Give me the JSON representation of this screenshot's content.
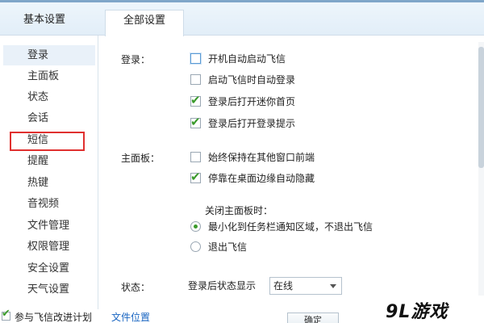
{
  "tabs": [
    {
      "label": "基本设置"
    },
    {
      "label": "全部设置"
    }
  ],
  "sidebar": {
    "items": [
      {
        "label": "登录"
      },
      {
        "label": "主面板"
      },
      {
        "label": "状态"
      },
      {
        "label": "会话"
      },
      {
        "label": "短信"
      },
      {
        "label": "提醒"
      },
      {
        "label": "热键"
      },
      {
        "label": "音视频"
      },
      {
        "label": "文件管理"
      },
      {
        "label": "权限管理"
      },
      {
        "label": "安全设置"
      },
      {
        "label": "天气设置"
      }
    ]
  },
  "login": {
    "label": "登录：",
    "options": [
      {
        "label": "开机自动启动飞信",
        "checked": false
      },
      {
        "label": "启动飞信时自动登录",
        "checked": false
      },
      {
        "label": "登录后打开迷你首页",
        "checked": true
      },
      {
        "label": "登录后打开登录提示",
        "checked": true
      }
    ]
  },
  "main_panel": {
    "label": "主面板：",
    "options": [
      {
        "label": "始终保持在其他窗口前端",
        "checked": false
      },
      {
        "label": "停靠在桌面边缘自动隐藏",
        "checked": true
      }
    ],
    "close_heading": "关闭主面板时：",
    "close_options": [
      {
        "label": "最小化到任务栏通知区域，不退出飞信",
        "selected": true
      },
      {
        "label": "退出飞信",
        "selected": false
      }
    ]
  },
  "status": {
    "label": "状态：",
    "sub_label": "登录后状态显示",
    "value": "在线"
  },
  "footer": {
    "agree_text": "参与飞信改进计划",
    "agree_link": "文件位置",
    "ok_label": "确定"
  },
  "watermark": {
    "text": "9L游戏"
  },
  "colors": {
    "accent": "#3a9a2b",
    "highlight_box": "#e0302f",
    "link": "#1a66c2"
  }
}
